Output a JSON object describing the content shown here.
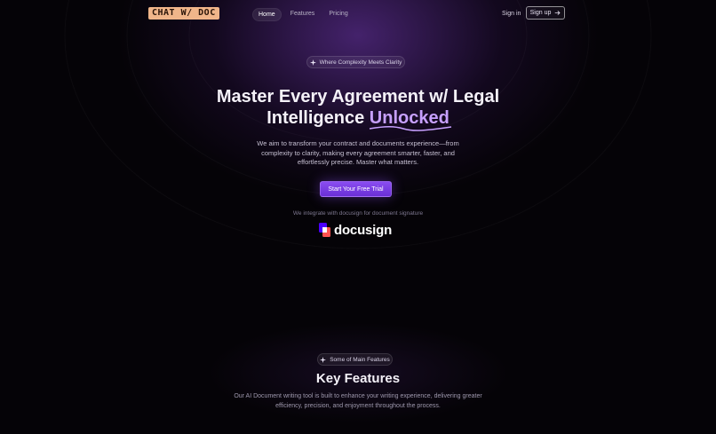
{
  "nav": {
    "logo": "CHAT W/ DOC",
    "links": [
      {
        "label": "Home",
        "active": true
      },
      {
        "label": "Features",
        "active": false
      },
      {
        "label": "Pricing",
        "active": false
      }
    ],
    "signin": "Sign in",
    "signup": "Sign up"
  },
  "hero": {
    "badge": "Where Complexity Meets Clarity",
    "title_line1": "Master Every Agreement w/ Legal",
    "title_line2_prefix": "Intelligence",
    "title_line2_accent": "Unlocked",
    "subtitle": "We aim to transform your contract and documents experience—from complexity to clarity, making every agreement smarter, faster, and effortlessly precise. Master what matters.",
    "cta": "Start Your Free Trial",
    "integrate_text": "We integrate with docusign for document signature",
    "partner": "docusign"
  },
  "features": {
    "badge": "Some of Main Features",
    "title": "Key Features",
    "subtitle": "Our AI Document writing tool is built to enhance your writing experience, delivering greater efficiency, precision, and enjoyment throughout the process."
  },
  "colors": {
    "accent": "#8a4df0",
    "accent_text": "#c7a0ff",
    "logo_bg": "#f0b58a",
    "background": "#050307"
  },
  "icons": {
    "badge": "sparkle-icon",
    "signup": "arrow-right-icon",
    "partner": "docusign-logo-icon"
  }
}
